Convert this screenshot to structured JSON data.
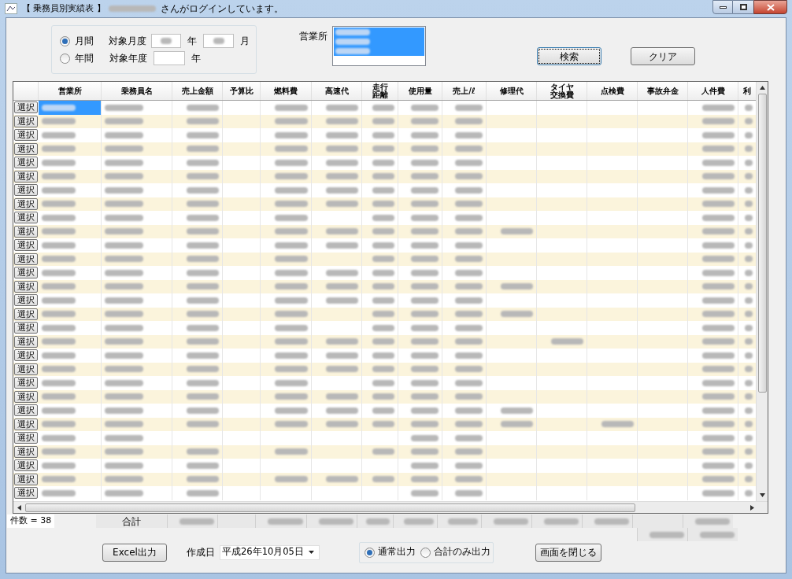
{
  "window": {
    "title": "【 乗務員別実績表 】",
    "login_suffix": "さんがログインしています。"
  },
  "period": {
    "options": [
      {
        "label": "月間",
        "selected": true,
        "field_label": "対象月度",
        "fields": [
          {
            "kind": "masked",
            "unit": "年"
          },
          {
            "kind": "masked",
            "unit": "月"
          }
        ]
      },
      {
        "label": "年間",
        "selected": false,
        "field_label": "対象年度",
        "fields": [
          {
            "kind": "empty",
            "unit": "年"
          }
        ]
      }
    ]
  },
  "office": {
    "label": "営業所",
    "items": [
      {
        "selected": true
      },
      {
        "selected": true
      },
      {
        "selected": true
      }
    ]
  },
  "search_button": {
    "label": "検索",
    "focused": true
  },
  "clear_button": {
    "label": "クリア",
    "focused": false
  },
  "table": {
    "columns": [
      {
        "label": "営業所",
        "kind": "text"
      },
      {
        "label": "乗務員名",
        "kind": "text"
      },
      {
        "label": "売上金額",
        "kind": "number"
      },
      {
        "label": "予算比",
        "kind": "number"
      },
      {
        "label": "燃料費",
        "kind": "number"
      },
      {
        "label": "高速代",
        "kind": "number"
      },
      {
        "label": "走行距離",
        "kind": "number"
      },
      {
        "label": "使用量",
        "kind": "number"
      },
      {
        "label": "売上/ℓ",
        "kind": "number"
      },
      {
        "label": "修理代",
        "kind": "number"
      },
      {
        "label": "タイヤ交換費",
        "kind": "number"
      },
      {
        "label": "点検費",
        "kind": "number"
      },
      {
        "label": "事故弁金",
        "kind": "number"
      },
      {
        "label": "人件費",
        "kind": "number"
      },
      {
        "label": "利",
        "kind": "number"
      }
    ],
    "rows": [
      {
        "select_label": "選択",
        "selected": true,
        "masked": [
          true,
          true,
          true,
          false,
          true,
          true,
          true,
          true,
          true,
          false,
          false,
          false,
          false,
          true,
          true
        ]
      },
      {
        "select_label": "選択",
        "selected": false,
        "masked": [
          true,
          true,
          true,
          false,
          true,
          true,
          true,
          true,
          true,
          false,
          false,
          false,
          false,
          true,
          true
        ]
      },
      {
        "select_label": "選択",
        "selected": false,
        "masked": [
          true,
          true,
          true,
          false,
          true,
          true,
          true,
          true,
          true,
          false,
          false,
          false,
          false,
          true,
          true
        ]
      },
      {
        "select_label": "選択",
        "selected": false,
        "masked": [
          true,
          true,
          true,
          false,
          true,
          true,
          true,
          true,
          true,
          false,
          false,
          false,
          false,
          true,
          true
        ]
      },
      {
        "select_label": "選択",
        "selected": false,
        "masked": [
          true,
          true,
          true,
          false,
          true,
          true,
          true,
          true,
          true,
          false,
          false,
          false,
          false,
          true,
          true
        ]
      },
      {
        "select_label": "選択",
        "selected": false,
        "masked": [
          true,
          true,
          true,
          false,
          true,
          true,
          true,
          true,
          true,
          false,
          false,
          false,
          false,
          true,
          true
        ]
      },
      {
        "select_label": "選択",
        "selected": false,
        "masked": [
          true,
          true,
          true,
          false,
          true,
          true,
          true,
          true,
          true,
          false,
          false,
          false,
          false,
          true,
          true
        ]
      },
      {
        "select_label": "選択",
        "selected": false,
        "masked": [
          true,
          true,
          true,
          false,
          true,
          true,
          true,
          true,
          true,
          false,
          false,
          false,
          false,
          true,
          true
        ]
      },
      {
        "select_label": "選択",
        "selected": false,
        "masked": [
          true,
          true,
          true,
          false,
          true,
          false,
          true,
          true,
          true,
          false,
          false,
          false,
          false,
          true,
          true
        ]
      },
      {
        "select_label": "選択",
        "selected": false,
        "masked": [
          true,
          true,
          true,
          false,
          true,
          true,
          true,
          true,
          true,
          true,
          false,
          false,
          false,
          true,
          true
        ]
      },
      {
        "select_label": "選択",
        "selected": false,
        "masked": [
          true,
          true,
          true,
          false,
          true,
          true,
          true,
          true,
          true,
          false,
          false,
          false,
          false,
          true,
          true
        ]
      },
      {
        "select_label": "選択",
        "selected": false,
        "masked": [
          true,
          true,
          true,
          false,
          true,
          false,
          true,
          true,
          true,
          false,
          false,
          false,
          false,
          true,
          true
        ]
      },
      {
        "select_label": "選択",
        "selected": false,
        "masked": [
          true,
          true,
          true,
          false,
          true,
          true,
          true,
          true,
          true,
          false,
          false,
          false,
          false,
          true,
          true
        ]
      },
      {
        "select_label": "選択",
        "selected": false,
        "masked": [
          true,
          true,
          true,
          false,
          true,
          true,
          true,
          true,
          true,
          true,
          false,
          false,
          false,
          true,
          true
        ]
      },
      {
        "select_label": "選択",
        "selected": false,
        "masked": [
          true,
          true,
          true,
          false,
          true,
          true,
          true,
          true,
          true,
          false,
          false,
          false,
          false,
          true,
          true
        ]
      },
      {
        "select_label": "選択",
        "selected": false,
        "masked": [
          true,
          true,
          true,
          false,
          true,
          false,
          true,
          true,
          true,
          true,
          false,
          false,
          false,
          true,
          true
        ]
      },
      {
        "select_label": "選択",
        "selected": false,
        "masked": [
          true,
          true,
          true,
          false,
          true,
          false,
          true,
          true,
          true,
          false,
          false,
          false,
          false,
          true,
          true
        ]
      },
      {
        "select_label": "選択",
        "selected": false,
        "masked": [
          true,
          true,
          true,
          false,
          true,
          true,
          true,
          true,
          true,
          false,
          true,
          false,
          false,
          true,
          true
        ]
      },
      {
        "select_label": "選択",
        "selected": false,
        "masked": [
          true,
          true,
          true,
          false,
          true,
          true,
          true,
          true,
          true,
          false,
          false,
          false,
          false,
          true,
          true
        ]
      },
      {
        "select_label": "選択",
        "selected": false,
        "masked": [
          true,
          true,
          true,
          false,
          true,
          true,
          true,
          true,
          true,
          false,
          false,
          false,
          false,
          true,
          true
        ]
      },
      {
        "select_label": "選択",
        "selected": false,
        "masked": [
          true,
          true,
          true,
          false,
          true,
          false,
          true,
          true,
          true,
          false,
          false,
          false,
          false,
          true,
          true
        ]
      },
      {
        "select_label": "選択",
        "selected": false,
        "masked": [
          true,
          true,
          true,
          false,
          true,
          true,
          true,
          true,
          true,
          false,
          false,
          false,
          false,
          true,
          true
        ]
      },
      {
        "select_label": "選択",
        "selected": false,
        "masked": [
          true,
          true,
          true,
          false,
          true,
          true,
          true,
          true,
          true,
          true,
          false,
          false,
          false,
          true,
          true
        ]
      },
      {
        "select_label": "選択",
        "selected": false,
        "masked": [
          true,
          true,
          true,
          false,
          true,
          true,
          true,
          true,
          true,
          true,
          false,
          true,
          false,
          true,
          true
        ]
      },
      {
        "select_label": "選択",
        "selected": false,
        "masked": [
          true,
          true,
          false,
          false,
          false,
          false,
          false,
          true,
          true,
          false,
          false,
          false,
          false,
          true,
          true
        ]
      },
      {
        "select_label": "選択",
        "selected": false,
        "masked": [
          true,
          true,
          true,
          false,
          true,
          false,
          true,
          true,
          true,
          false,
          false,
          false,
          false,
          true,
          true
        ]
      },
      {
        "select_label": "選択",
        "selected": false,
        "masked": [
          true,
          true,
          true,
          false,
          false,
          false,
          false,
          true,
          true,
          false,
          false,
          false,
          false,
          true,
          true
        ]
      },
      {
        "select_label": "選択",
        "selected": false,
        "masked": [
          true,
          true,
          true,
          false,
          true,
          true,
          true,
          true,
          true,
          false,
          false,
          false,
          false,
          true,
          true
        ]
      },
      {
        "select_label": "選択",
        "selected": false,
        "masked": [
          true,
          true,
          true,
          false,
          false,
          false,
          false,
          true,
          true,
          false,
          false,
          false,
          false,
          true,
          true
        ]
      }
    ]
  },
  "count": "件数 = 38",
  "totals": {
    "label": "合計",
    "masked": [
      true,
      false,
      true,
      true,
      true,
      true,
      true,
      true,
      true,
      true,
      false,
      true
    ],
    "extra_masked": [
      true,
      true
    ]
  },
  "excel_button": "Excel出力",
  "date": {
    "label": "作成日",
    "value": "平成26年10月05日"
  },
  "output_options": [
    {
      "label": "通常出力",
      "selected": true
    },
    {
      "label": "合計のみ出力",
      "selected": false
    }
  ],
  "close_button": "画面を閉じる"
}
